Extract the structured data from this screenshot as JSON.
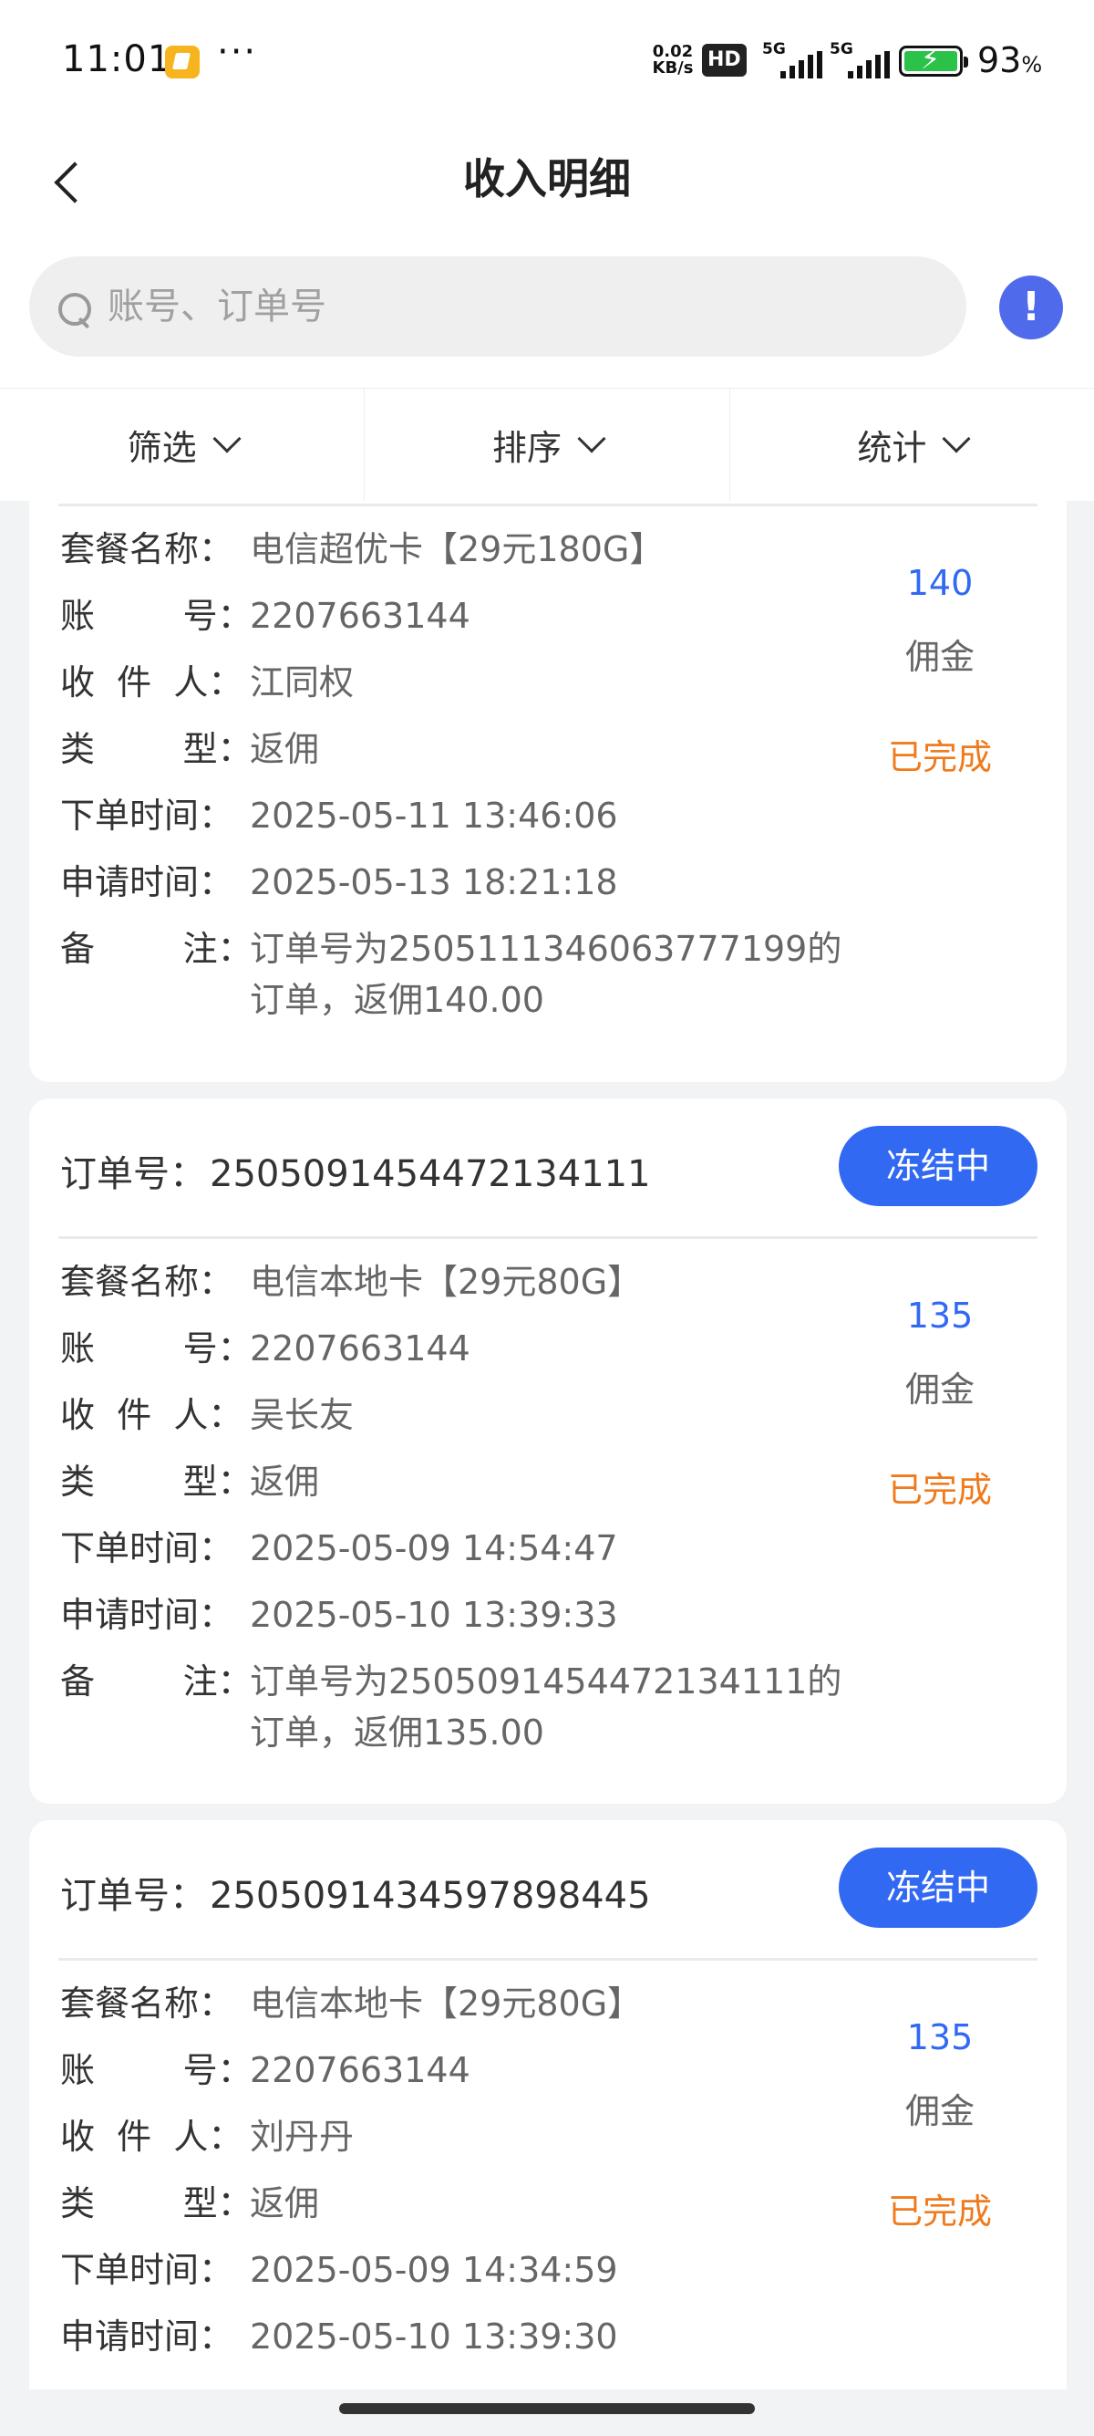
{
  "status_bar": {
    "time": "11:01",
    "dots": "···",
    "net_speed_value": "0.02",
    "net_speed_unit": "KB/s",
    "hd_badge": "HD",
    "signal1": "5G",
    "signal2": "5G",
    "battery_percent": "93",
    "battery_unit": "%"
  },
  "header": {
    "title": "收入明细"
  },
  "search": {
    "placeholder": "账号、订单号",
    "value": ""
  },
  "info_button": "!",
  "filters": [
    {
      "label": "筛选"
    },
    {
      "label": "排序"
    },
    {
      "label": "统计"
    }
  ],
  "labels": {
    "order_no": "订单号：",
    "package": "套餐名称：",
    "account": "账        号：",
    "recipient": "收  件  人：",
    "type": "类        型：",
    "order_time": "下单时间：",
    "apply_time": "申请时间：",
    "remark": "备        注：",
    "commission_unit": "佣金"
  },
  "orders": [
    {
      "package": "电信超优卡【29元180G】",
      "account": "2207663144",
      "recipient": "江同权",
      "type": "返佣",
      "order_time": "2025-05-11 13:46:06",
      "apply_time": "2025-05-13 18:21:18",
      "remark_line1": "订单号为2505111346063777199的",
      "remark_line2": "订单，返佣140.00",
      "commission": "140",
      "status": "已完成"
    },
    {
      "order_no": "2505091454472134111",
      "button": "冻结中",
      "package": "电信本地卡【29元80G】",
      "account": "2207663144",
      "recipient": "吴长友",
      "type": "返佣",
      "order_time": "2025-05-09 14:54:47",
      "apply_time": "2025-05-10 13:39:33",
      "remark_line1": "订单号为2505091454472134111的",
      "remark_line2": "订单，返佣135.00",
      "commission": "135",
      "status": "已完成"
    },
    {
      "order_no": "2505091434597898445",
      "button": "冻结中",
      "package": "电信本地卡【29元80G】",
      "account": "2207663144",
      "recipient": "刘丹丹",
      "type": "返佣",
      "order_time": "2025-05-09 14:34:59",
      "apply_time": "2025-05-10 13:39:30",
      "commission": "135",
      "status": "已完成"
    }
  ]
}
